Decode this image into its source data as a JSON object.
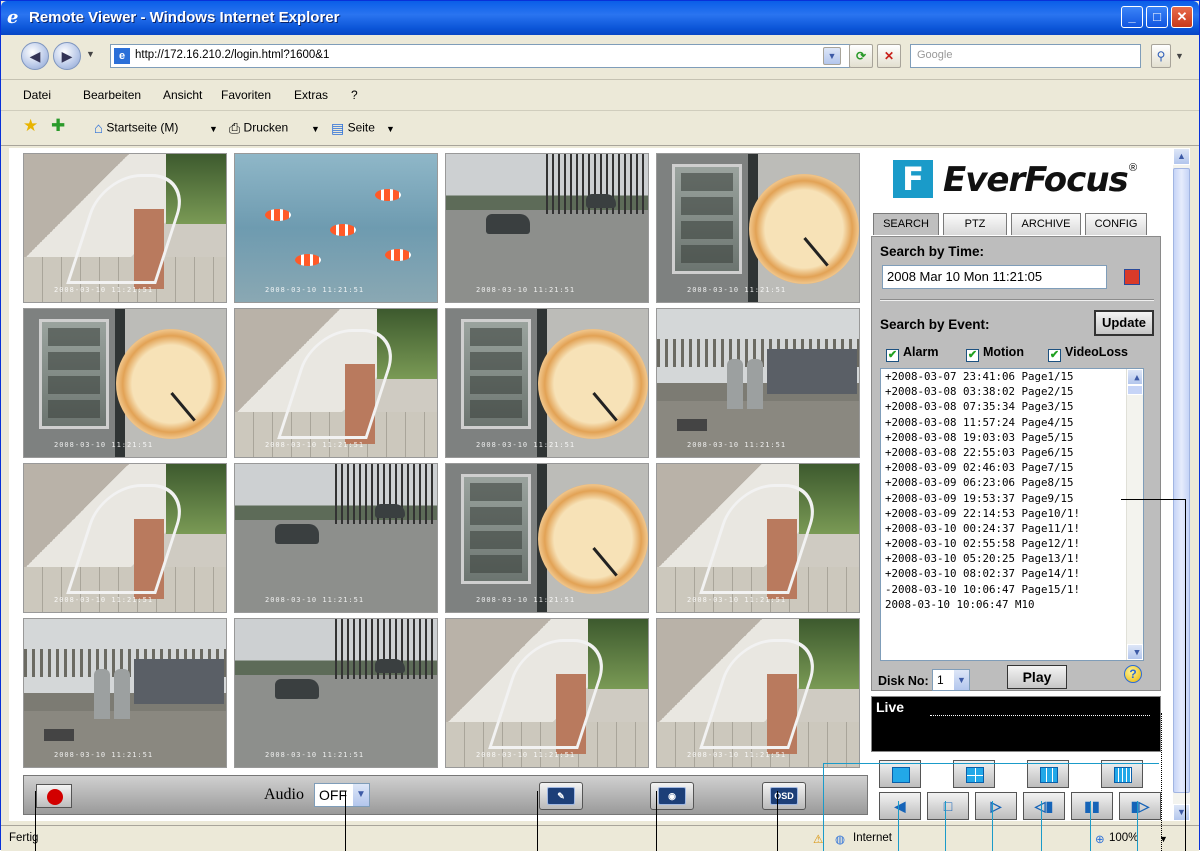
{
  "window": {
    "title": "Remote Viewer - Windows Internet Explorer",
    "url": "http://172.16.210.2/login.html?1600&1",
    "search_placeholder": "Google"
  },
  "menu": [
    "Datei",
    "Bearbeiten",
    "Ansicht",
    "Favoriten",
    "Extras",
    "?"
  ],
  "toolbar": {
    "home": "Startseite (M)",
    "print": "Drucken",
    "page": "Seite"
  },
  "cameras": [
    {
      "scene": "stairs",
      "ts": "2008-03-10  11:21:51"
    },
    {
      "scene": "fish",
      "ts": "2008-03-10  11:21:51"
    },
    {
      "scene": "street",
      "ts": "2008-03-10  11:21:51"
    },
    {
      "scene": "clock",
      "ts": "2008-03-10  11:21:51"
    },
    {
      "scene": "clock",
      "ts": "2008-03-10  11:21:51"
    },
    {
      "scene": "stairs",
      "ts": "2008-03-10  11:21:51"
    },
    {
      "scene": "clock",
      "ts": "2008-03-10  11:21:51"
    },
    {
      "scene": "industrial",
      "ts": "2008-03-10  11:21:51"
    },
    {
      "scene": "stairs",
      "ts": "2008-03-10  11:21:51"
    },
    {
      "scene": "street",
      "ts": "2008-03-10  11:21:51"
    },
    {
      "scene": "clock",
      "ts": "2008-03-10  11:21:51"
    },
    {
      "scene": "stairs",
      "ts": "2008-03-10  11:21:51"
    },
    {
      "scene": "industrial",
      "ts": "2008-03-10  11:21:51"
    },
    {
      "scene": "street",
      "ts": "2008-03-10  11:21:51"
    },
    {
      "scene": "stairs",
      "ts": "2008-03-10  11:21:51"
    },
    {
      "scene": "stairs",
      "ts": "2008-03-10  11:21:51"
    }
  ],
  "controls": {
    "audio_label": "Audio",
    "audio_value": "OFF",
    "osd_label": "OSD"
  },
  "panel": {
    "brand": "EverFocus",
    "brand_mark": "®",
    "tabs": [
      "SEARCH",
      "PTZ",
      "ARCHIVE",
      "CONFIG"
    ],
    "search_by_time": "Search by Time:",
    "time_value": "2008 Mar 10 Mon 11:21:05",
    "search_by_event": "Search by Event:",
    "update": "Update",
    "checks": [
      "Alarm",
      "Motion",
      "VideoLoss"
    ],
    "events": [
      "+2008-03-07 23:41:06 Page1/15",
      "+2008-03-08 03:38:02 Page2/15",
      "+2008-03-08 07:35:34 Page3/15",
      "+2008-03-08 11:57:24 Page4/15",
      "+2008-03-08 19:03:03 Page5/15",
      "+2008-03-08 22:55:03 Page6/15",
      "+2008-03-09 02:46:03 Page7/15",
      "+2008-03-09 06:23:06 Page8/15",
      "+2008-03-09 19:53:37 Page9/15",
      "+2008-03-09 22:14:53 Page10/1!",
      "+2008-03-10 00:24:37 Page11/1!",
      "+2008-03-10 02:55:58 Page12/1!",
      "+2008-03-10 05:20:25 Page13/1!",
      "+2008-03-10 08:02:37 Page14/1!",
      "-2008-03-10 10:06:47 Page15/1!",
      " 2008-03-10 10:06:47    M10"
    ],
    "disk_label": "Disk No:",
    "disk_value": "1",
    "play": "Play",
    "help": "?",
    "live": "Live"
  },
  "status": {
    "left": "Fertig",
    "zone": "Internet",
    "zoom": "100%"
  }
}
